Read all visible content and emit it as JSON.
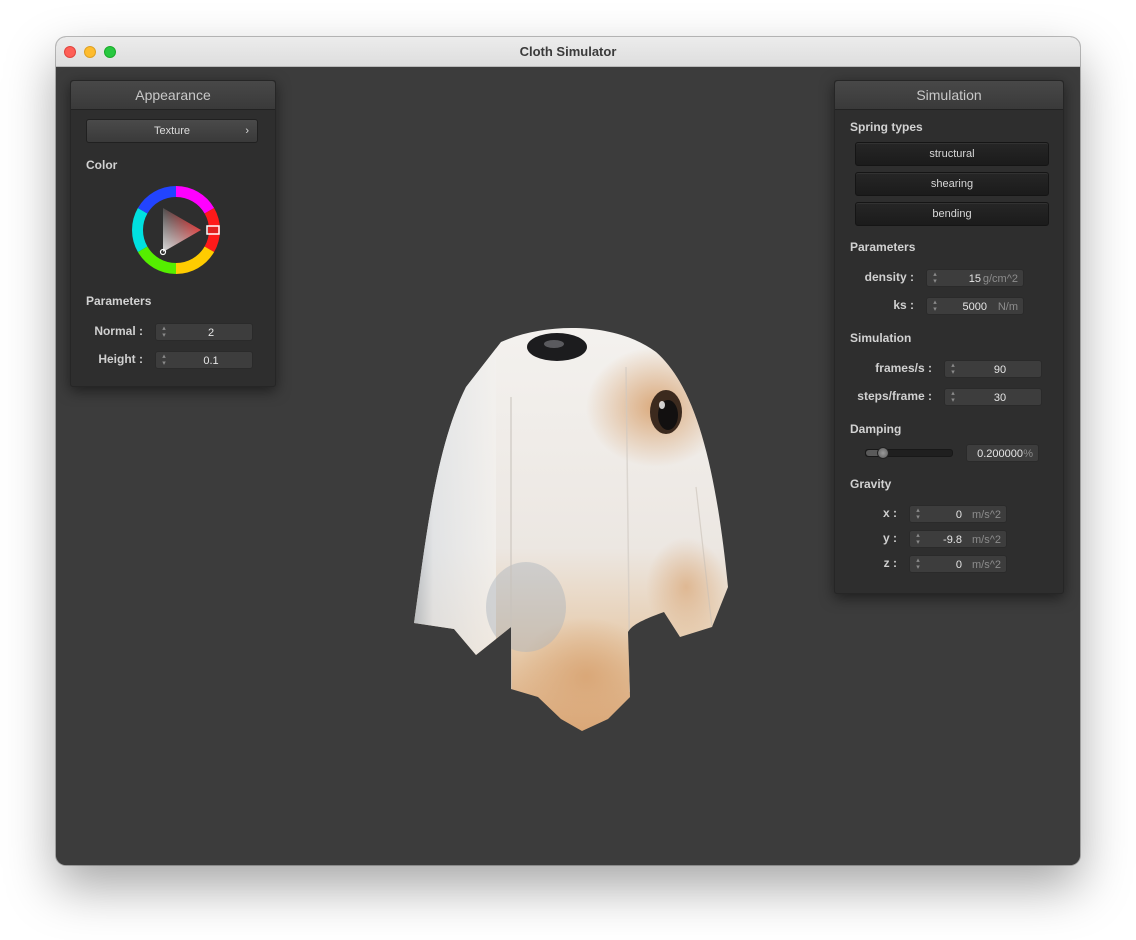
{
  "window": {
    "title": "Cloth Simulator"
  },
  "appearance": {
    "header": "Appearance",
    "texture_button": "Texture",
    "color_label": "Color",
    "parameters_label": "Parameters",
    "normal_label": "Normal :",
    "normal_value": "2",
    "height_label": "Height :",
    "height_value": "0.1",
    "selected_color": "#e02020"
  },
  "simulation": {
    "header": "Simulation",
    "spring_types_label": "Spring types",
    "spring_buttons": [
      "structural",
      "shearing",
      "bending"
    ],
    "parameters_label": "Parameters",
    "density_label": "density :",
    "density_value": "15",
    "density_unit": "g/cm^2",
    "ks_label": "ks :",
    "ks_value": "5000",
    "ks_unit": "N/m",
    "simulation_label": "Simulation",
    "fps_label": "frames/s :",
    "fps_value": "90",
    "steps_label": "steps/frame :",
    "steps_value": "30",
    "damping_label": "Damping",
    "damping_value": "0.200000",
    "damping_unit": "%",
    "damping_fraction": 0.2,
    "gravity_label": "Gravity",
    "gx_label": "x :",
    "gx_value": "0",
    "gy_label": "y :",
    "gy_value": "-9.8",
    "gz_label": "z :",
    "gz_value": "0",
    "gravity_unit": "m/s^2"
  }
}
